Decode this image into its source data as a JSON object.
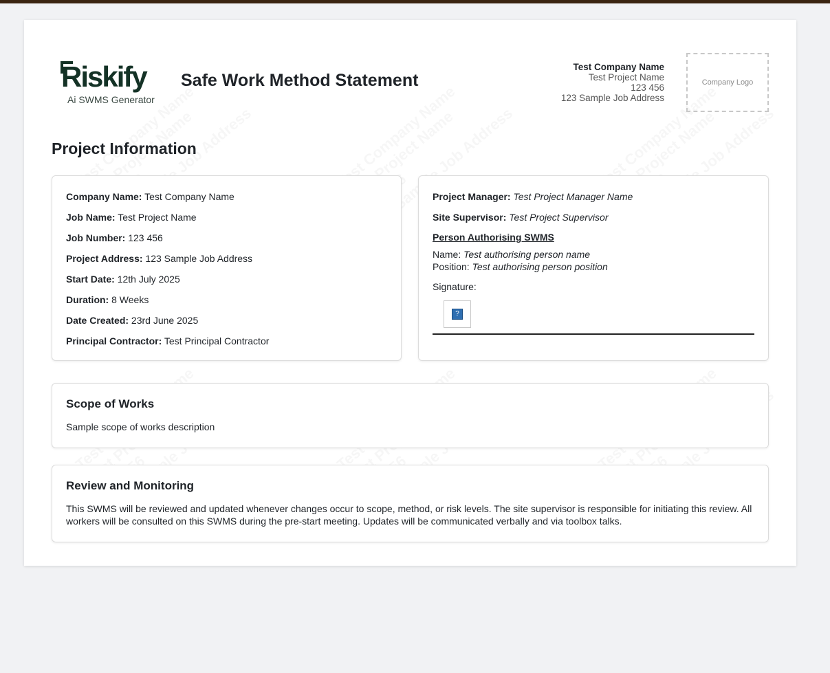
{
  "header": {
    "logo_text": "Riskify",
    "logo_subtitle": "Ai SWMS Generator",
    "title": "Safe Work Method Statement",
    "company_name": "Test Company Name",
    "project_name": "Test Project Name",
    "job_number": "123 456",
    "job_address": "123 Sample Job Address",
    "company_logo_placeholder": "Company Logo"
  },
  "project_info": {
    "section_title": "Project Information",
    "left": [
      {
        "label": "Company Name:",
        "value": "Test Company Name"
      },
      {
        "label": "Job Name:",
        "value": "Test Project Name"
      },
      {
        "label": "Job Number:",
        "value": "123 456"
      },
      {
        "label": "Project Address:",
        "value": "123 Sample Job Address"
      },
      {
        "label": "Start Date:",
        "value": "12th July 2025"
      },
      {
        "label": "Duration:",
        "value": "8 Weeks"
      },
      {
        "label": "Date Created:",
        "value": "23rd June 2025"
      },
      {
        "label": "Principal Contractor:",
        "value": "Test Principal Contractor"
      }
    ],
    "right": {
      "project_manager_label": "Project Manager:",
      "project_manager": "Test Project Manager Name",
      "site_supervisor_label": "Site Supervisor:",
      "site_supervisor": "Test Project Supervisor",
      "authorising_heading": "Person Authorising SWMS",
      "name_label": "Name:",
      "name": "Test authorising person name",
      "position_label": "Position:",
      "position": "Test authorising person position",
      "signature_label": "Signature:",
      "signature_placeholder": "?"
    }
  },
  "scope": {
    "title": "Scope of Works",
    "text": "Sample scope of works description"
  },
  "review": {
    "title": "Review and Monitoring",
    "text": "This SWMS will be reviewed and updated whenever changes occur to scope, method, or risk levels. The site supervisor is responsible for initiating this review. All workers will be consulted on this SWMS during the pre-start meeting. Updates will be communicated verbally and via toolbox talks."
  },
  "watermark": [
    "Test Company Name",
    "Test Project Name",
    "123 456",
    "123 Sample Job Address"
  ]
}
